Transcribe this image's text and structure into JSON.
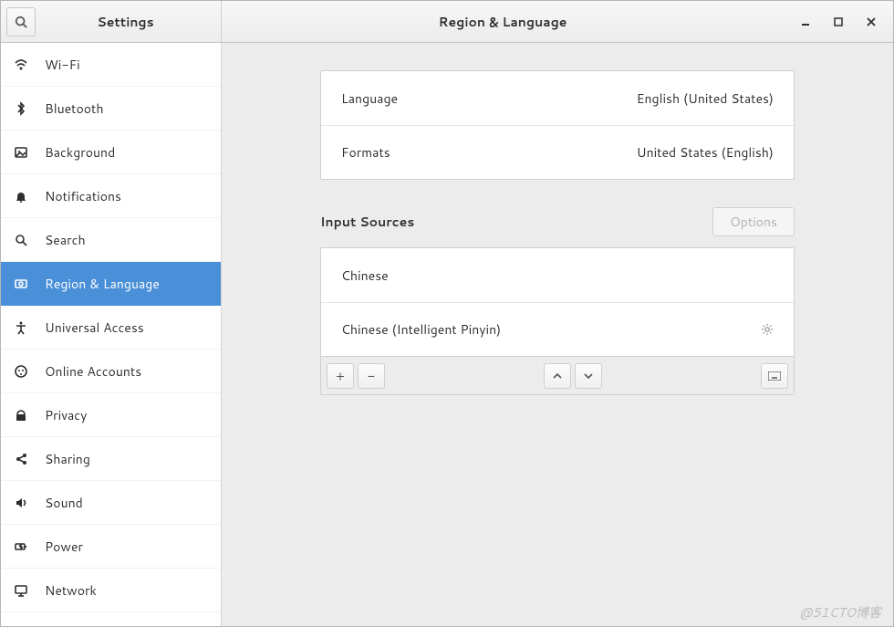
{
  "titlebar": {
    "left_title": "Settings",
    "center_title": "Region & Language"
  },
  "sidebar": {
    "items": [
      {
        "icon": "wifi",
        "label": "Wi-Fi"
      },
      {
        "icon": "bluetooth",
        "label": "Bluetooth"
      },
      {
        "icon": "background",
        "label": "Background"
      },
      {
        "icon": "bell",
        "label": "Notifications"
      },
      {
        "icon": "search",
        "label": "Search"
      },
      {
        "icon": "region",
        "label": "Region & Language"
      },
      {
        "icon": "access",
        "label": "Universal Access"
      },
      {
        "icon": "online",
        "label": "Online Accounts"
      },
      {
        "icon": "privacy",
        "label": "Privacy"
      },
      {
        "icon": "share",
        "label": "Sharing"
      },
      {
        "icon": "sound",
        "label": "Sound"
      },
      {
        "icon": "power",
        "label": "Power"
      },
      {
        "icon": "network",
        "label": "Network"
      }
    ],
    "selected_index": 5
  },
  "settings_rows": [
    {
      "label": "Language",
      "value": "English (United States)"
    },
    {
      "label": "Formats",
      "value": "United States (English)"
    }
  ],
  "input_sources": {
    "heading": "Input Sources",
    "options_label": "Options",
    "items": [
      {
        "label": "Chinese",
        "has_prefs": false
      },
      {
        "label": "Chinese (Intelligent Pinyin)",
        "has_prefs": true
      }
    ]
  },
  "watermark": "@51CTO博客"
}
